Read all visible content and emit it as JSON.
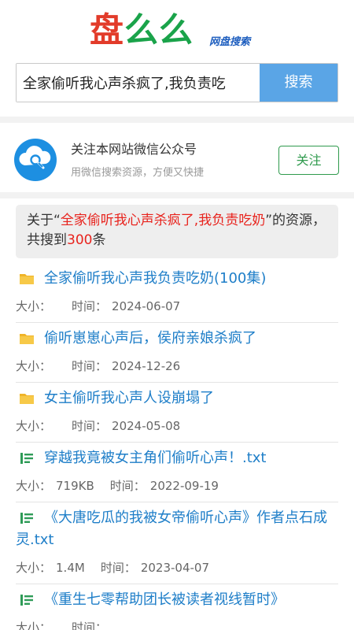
{
  "logo": {
    "part1": "盘",
    "part2": "么么",
    "subtitle": "网盘搜索"
  },
  "search": {
    "query": "全家偷听我心声杀疯了,我负责吃",
    "button_label": "搜索"
  },
  "follow": {
    "title": "关注本网站微信公众号",
    "subtitle": "用微信搜索资源，方便又快捷",
    "button_label": "关注"
  },
  "summary": {
    "prefix": "关于“",
    "keyword": "全家偷听我心声杀疯了,我负责吃奶",
    "middle": "”的资源，共搜到",
    "count": "300",
    "suffix": "条"
  },
  "labels": {
    "size": "大小：",
    "time": "时间："
  },
  "results": [
    {
      "type": "folder",
      "title": "全家偷听我心声我负责吃奶(100集)",
      "size": "",
      "time": "2024-06-07"
    },
    {
      "type": "folder",
      "title": "偷听崽崽心声后，侯府亲娘杀疯了",
      "size": "",
      "time": "2024-12-26"
    },
    {
      "type": "folder",
      "title": "女主偷听我心声人设崩塌了",
      "size": "",
      "time": "2024-05-08"
    },
    {
      "type": "file",
      "title": "穿越我竟被女主角们偷听心声！.txt",
      "size": "719KB",
      "time": "2022-09-19"
    },
    {
      "type": "file",
      "title": "《大唐吃瓜的我被女帝偷听心声》作者点石成灵.txt",
      "size": "1.4M",
      "time": "2023-04-07"
    },
    {
      "type": "file",
      "title": "《重生七零帮助团长被读者视线暂时》",
      "size": "",
      "time": ""
    }
  ],
  "colors": {
    "accent": "#5aa5e6",
    "link": "#1e7ec8",
    "highlight": "#e8231d",
    "follow_green": "#2f9a4d"
  }
}
